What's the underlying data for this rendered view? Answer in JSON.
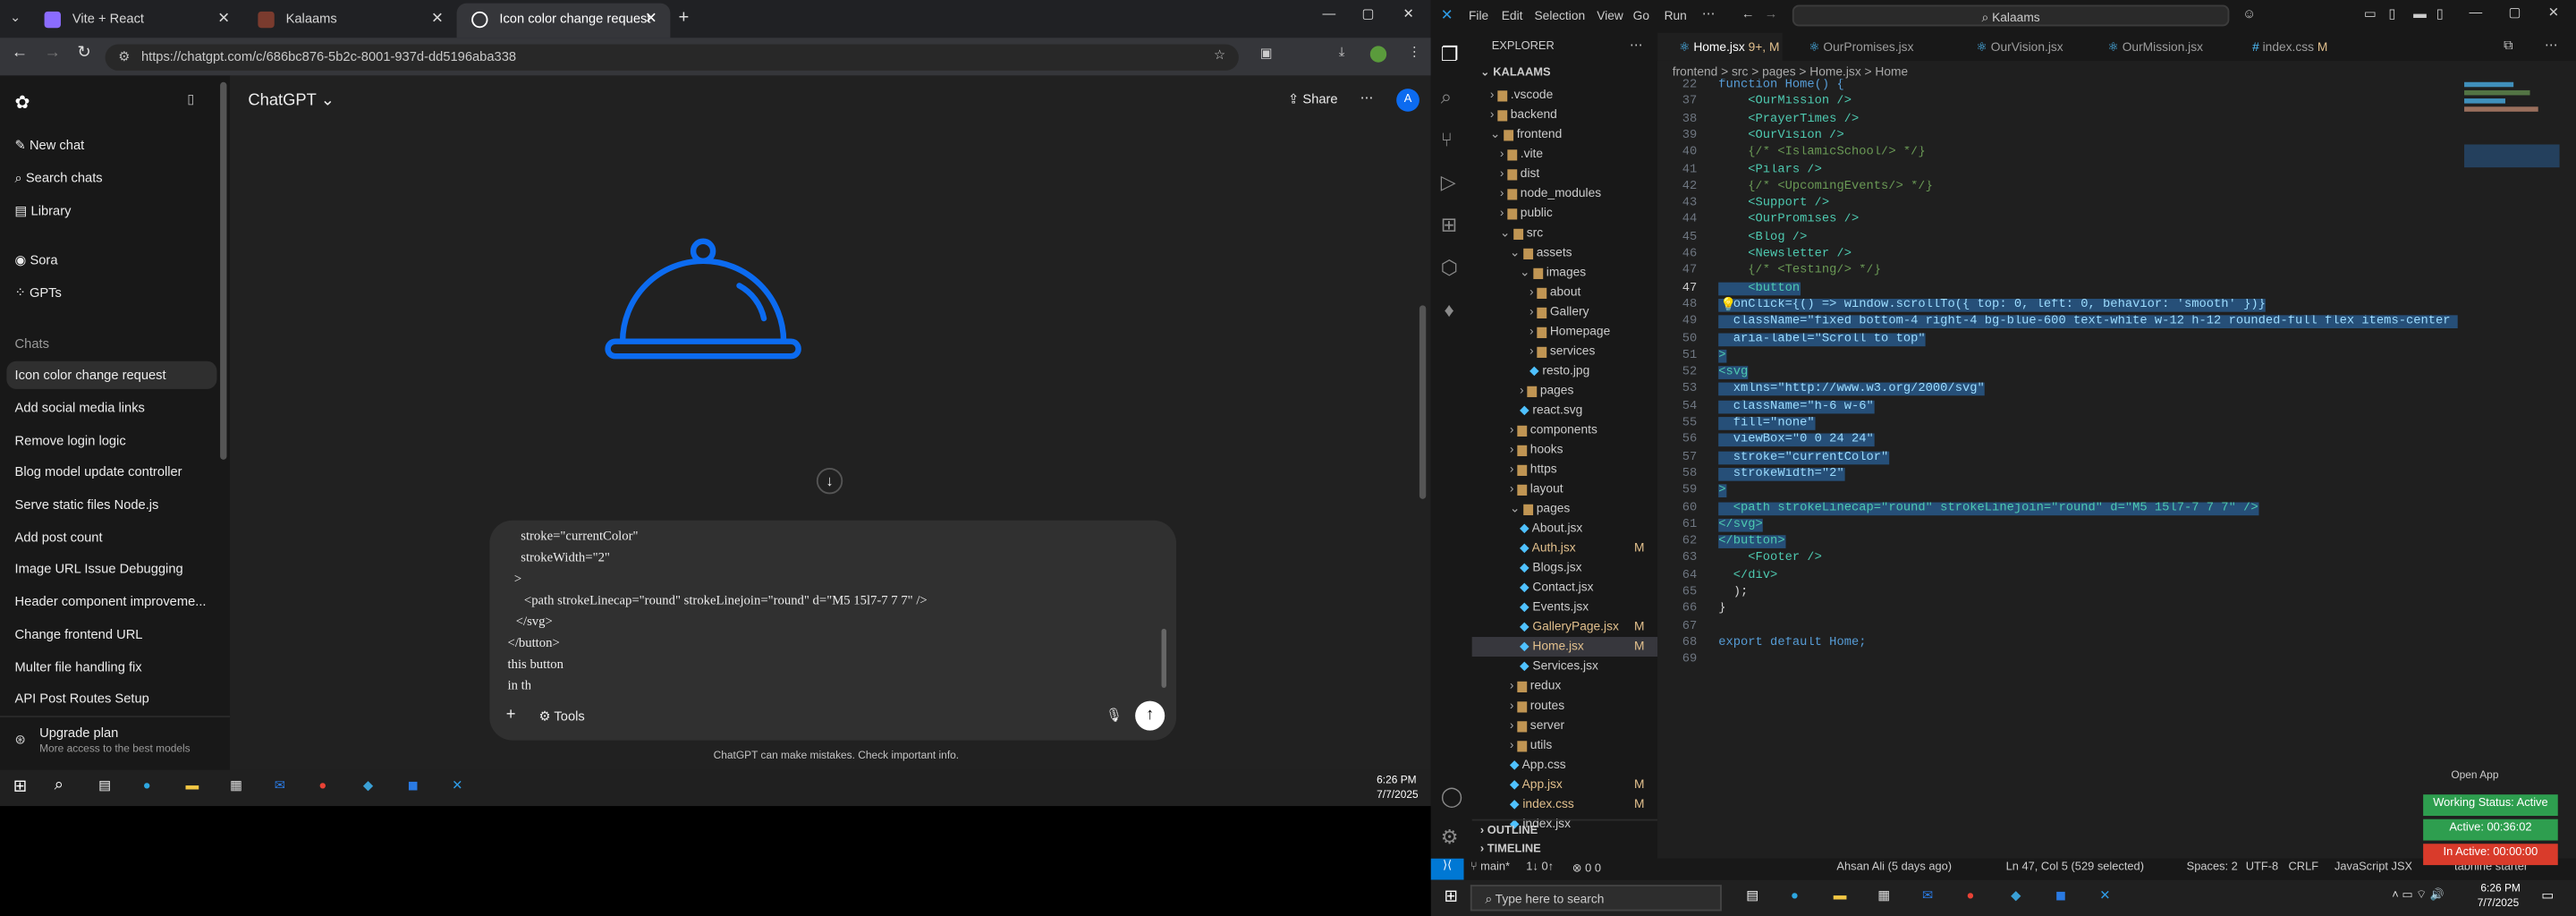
{
  "browser": {
    "tabs": [
      {
        "title": "Vite + React",
        "active": false
      },
      {
        "title": "Kalaams",
        "active": false
      },
      {
        "title": "Icon color change request",
        "active": true
      }
    ],
    "url": "https://chatgpt.com/c/686bc876-5b2c-8001-937d-dd5196aba338"
  },
  "chatgpt": {
    "brand": "ChatGPT",
    "menu": [
      "New chat",
      "Search chats",
      "Library",
      "Sora",
      "GPTs"
    ],
    "chats_heading": "Chats",
    "chats": [
      "Icon color change request",
      "Add social media links",
      "Remove login logic",
      "Blog model update controller",
      "Serve static files Node.js",
      "Add post count",
      "Image URL Issue Debugging",
      "Header component improveme...",
      "Change frontend URL",
      "Multer file handling fix",
      "API Post Routes Setup"
    ],
    "upgrade_title": "Upgrade plan",
    "upgrade_sub": "More access to the best models",
    "share": "Share",
    "composer_lines": [
      "stroke=\"currentColor\"",
      "strokeWidth=\"2\"",
      ">",
      "<path strokeLinecap=\"round\" strokeLinejoin=\"round\" d=\"M5 15l7-7 7 7\" />",
      "</svg>",
      "</button>",
      "this button",
      "in th"
    ],
    "tools": "Tools",
    "disclaimer": "ChatGPT can make mistakes. Check important info.",
    "accent": "#0c6bf0"
  },
  "taskbar_left": {
    "time": "6:26 PM",
    "date": "7/7/2025"
  },
  "vscode": {
    "menu": [
      "File",
      "Edit",
      "Selection",
      "View",
      "Go",
      "Run"
    ],
    "search": "Kalaams",
    "explorer_title": "EXPLORER",
    "root": "KALAAMS",
    "tree": [
      {
        "name": ".vscode",
        "depth": 1,
        "type": "folder"
      },
      {
        "name": "backend",
        "depth": 1,
        "type": "folder"
      },
      {
        "name": "frontend",
        "depth": 1,
        "type": "folder-open"
      },
      {
        "name": ".vite",
        "depth": 2,
        "type": "folder"
      },
      {
        "name": "dist",
        "depth": 2,
        "type": "folder"
      },
      {
        "name": "node_modules",
        "depth": 2,
        "type": "folder"
      },
      {
        "name": "public",
        "depth": 2,
        "type": "folder"
      },
      {
        "name": "src",
        "depth": 2,
        "type": "folder-open"
      },
      {
        "name": "assets",
        "depth": 3,
        "type": "folder-open"
      },
      {
        "name": "images",
        "depth": 4,
        "type": "folder-open"
      },
      {
        "name": "about",
        "depth": 5,
        "type": "folder"
      },
      {
        "name": "Gallery",
        "depth": 5,
        "type": "folder"
      },
      {
        "name": "Homepage",
        "depth": 5,
        "type": "folder"
      },
      {
        "name": "services",
        "depth": 5,
        "type": "folder"
      },
      {
        "name": "resto.jpg",
        "depth": 5,
        "type": "file"
      },
      {
        "name": "pages",
        "depth": 4,
        "type": "folder"
      },
      {
        "name": "react.svg",
        "depth": 4,
        "type": "file"
      },
      {
        "name": "components",
        "depth": 3,
        "type": "folder"
      },
      {
        "name": "hooks",
        "depth": 3,
        "type": "folder"
      },
      {
        "name": "https",
        "depth": 3,
        "type": "folder"
      },
      {
        "name": "layout",
        "depth": 3,
        "type": "folder"
      },
      {
        "name": "pages",
        "depth": 3,
        "type": "folder-open"
      },
      {
        "name": "About.jsx",
        "depth": 4,
        "type": "file"
      },
      {
        "name": "Auth.jsx",
        "depth": 4,
        "type": "file",
        "badge": "M"
      },
      {
        "name": "Blogs.jsx",
        "depth": 4,
        "type": "file"
      },
      {
        "name": "Contact.jsx",
        "depth": 4,
        "type": "file"
      },
      {
        "name": "Events.jsx",
        "depth": 4,
        "type": "file"
      },
      {
        "name": "GalleryPage.jsx",
        "depth": 4,
        "type": "file",
        "badge": "M"
      },
      {
        "name": "Home.jsx",
        "depth": 4,
        "type": "file",
        "badge": "M",
        "active": true
      },
      {
        "name": "Services.jsx",
        "depth": 4,
        "type": "file"
      },
      {
        "name": "redux",
        "depth": 3,
        "type": "folder"
      },
      {
        "name": "routes",
        "depth": 3,
        "type": "folder"
      },
      {
        "name": "server",
        "depth": 3,
        "type": "folder"
      },
      {
        "name": "utils",
        "depth": 3,
        "type": "folder"
      },
      {
        "name": "App.css",
        "depth": 3,
        "type": "file"
      },
      {
        "name": "App.jsx",
        "depth": 3,
        "type": "file",
        "badge": "M"
      },
      {
        "name": "index.css",
        "depth": 3,
        "type": "file",
        "badge": "M"
      },
      {
        "name": "index.jsx",
        "depth": 3,
        "type": "file"
      }
    ],
    "outline": "OUTLINE",
    "timeline": "TIMELINE",
    "editor_tabs": [
      "Home.jsx",
      "OurPromises.jsx",
      "OurVision.jsx",
      "OurMission.jsx",
      "index.css"
    ],
    "breadcrumb": "frontend > src > pages > Home.jsx > Home",
    "code_lines": [
      {
        "n": "22",
        "t": "function Home() {"
      },
      {
        "n": "37",
        "t": "    <OurMission />"
      },
      {
        "n": "38",
        "t": "    <PrayerTimes />"
      },
      {
        "n": "39",
        "t": "    <OurVision />"
      },
      {
        "n": "40",
        "t": "    {/* <IslamicSchool/> */}"
      },
      {
        "n": "41",
        "t": "    <Pilars />"
      },
      {
        "n": "42",
        "t": "    {/* <UpcomingEvents/> */}"
      },
      {
        "n": "43",
        "t": "    <Support />"
      },
      {
        "n": "44",
        "t": "    <OurPromises />"
      },
      {
        "n": "45",
        "t": "    <Blog />"
      },
      {
        "n": "46",
        "t": "    <Newsletter />"
      },
      {
        "n": "47",
        "t": "    {/* <Testing/> */}"
      },
      {
        "n": "47",
        "t": "    <button",
        "sel": true
      },
      {
        "n": "48",
        "t": "  onClick={() => window.scrollTo({ top: 0, left: 0, behavior: 'smooth' })}",
        "sel": true
      },
      {
        "n": "49",
        "t": "  className=\"fixed bottom-4 right-4 bg-blue-600 text-white w-12 h-12 rounded-full flex items-center jus",
        "sel": true
      },
      {
        "n": "50",
        "t": "  aria-label=\"Scroll to top\"",
        "sel": true
      },
      {
        "n": "51",
        "t": ">",
        "sel": true
      },
      {
        "n": "52",
        "t": "<svg",
        "sel": true
      },
      {
        "n": "53",
        "t": "  xmlns=\"http://www.w3.org/2000/svg\"",
        "sel": true
      },
      {
        "n": "54",
        "t": "  className=\"h-6 w-6\"",
        "sel": true
      },
      {
        "n": "55",
        "t": "  fill=\"none\"",
        "sel": true
      },
      {
        "n": "56",
        "t": "  viewBox=\"0 0 24 24\"",
        "sel": true
      },
      {
        "n": "57",
        "t": "  stroke=\"currentColor\"",
        "sel": true
      },
      {
        "n": "58",
        "t": "  strokeWidth=\"2\"",
        "sel": true
      },
      {
        "n": "59",
        "t": ">",
        "sel": true
      },
      {
        "n": "60",
        "t": "  <path strokeLinecap=\"round\" strokeLinejoin=\"round\" d=\"M5 15l7-7 7 7\" />",
        "sel": true
      },
      {
        "n": "61",
        "t": "</svg>",
        "sel": true
      },
      {
        "n": "62",
        "t": "</button>",
        "sel": true
      },
      {
        "n": "63",
        "t": "    <Footer />"
      },
      {
        "n": "64",
        "t": "  </div>"
      },
      {
        "n": "65",
        "t": "  );"
      },
      {
        "n": "66",
        "t": "}"
      },
      {
        "n": "67",
        "t": ""
      },
      {
        "n": "68",
        "t": "export default Home;"
      },
      {
        "n": "69",
        "t": ""
      }
    ],
    "status": {
      "branch": "main*",
      "sync": "1↓ 0↑",
      "problems": "0 0",
      "blame": "Ahsan Ali (5 days ago)",
      "position": "Ln 47, Col 5 (529 selected)",
      "spaces": "Spaces: 2",
      "encoding": "UTF-8",
      "eol": "CRLF",
      "language": "JavaScript JSX",
      "tabnine": "tabnine starter"
    },
    "overlay": {
      "open_app": "Open App",
      "working": "Working Status: Active",
      "active": "Active: 00:36:02",
      "inactive": "In Active: 00:00:00"
    }
  },
  "taskbar_right": {
    "search": "Type here to search",
    "time": "6:26 PM",
    "date": "7/7/2025"
  }
}
